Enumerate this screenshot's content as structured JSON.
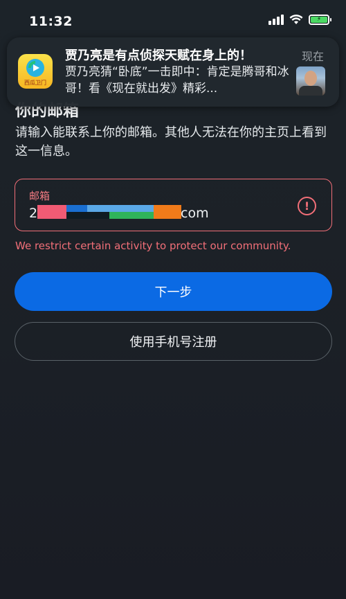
{
  "status_bar": {
    "time": "11:32",
    "battery_icon": "battery-charging-icon",
    "wifi_icon": "wifi-icon",
    "signal_icon": "cellular-signal-icon"
  },
  "notification": {
    "title": "贾乃亮是有点侦探天赋在身上的！",
    "time": "现在",
    "body": "贾乃亮猜“卧底”一击即中：肯定是腾哥和冰哥！看《现在就出发》精彩...",
    "app_icon": "video-play-icon",
    "app_brand": "西瓜卫门"
  },
  "page": {
    "title": "你的邮箱",
    "description": "请输入能联系上你的邮箱。其他人无法在你的主页上看到这一信息。"
  },
  "email_field": {
    "label": "邮箱",
    "value_prefix": "2",
    "value_suffix": "com",
    "error_icon": "alert-circle-icon"
  },
  "error_message": "We restrict certain activity to protect our community.",
  "buttons": {
    "next": "下一步",
    "phone_signup": "使用手机号注册"
  },
  "colors": {
    "background": "#1c2329",
    "primary": "#0b6ae4",
    "error": "#f26f78"
  }
}
